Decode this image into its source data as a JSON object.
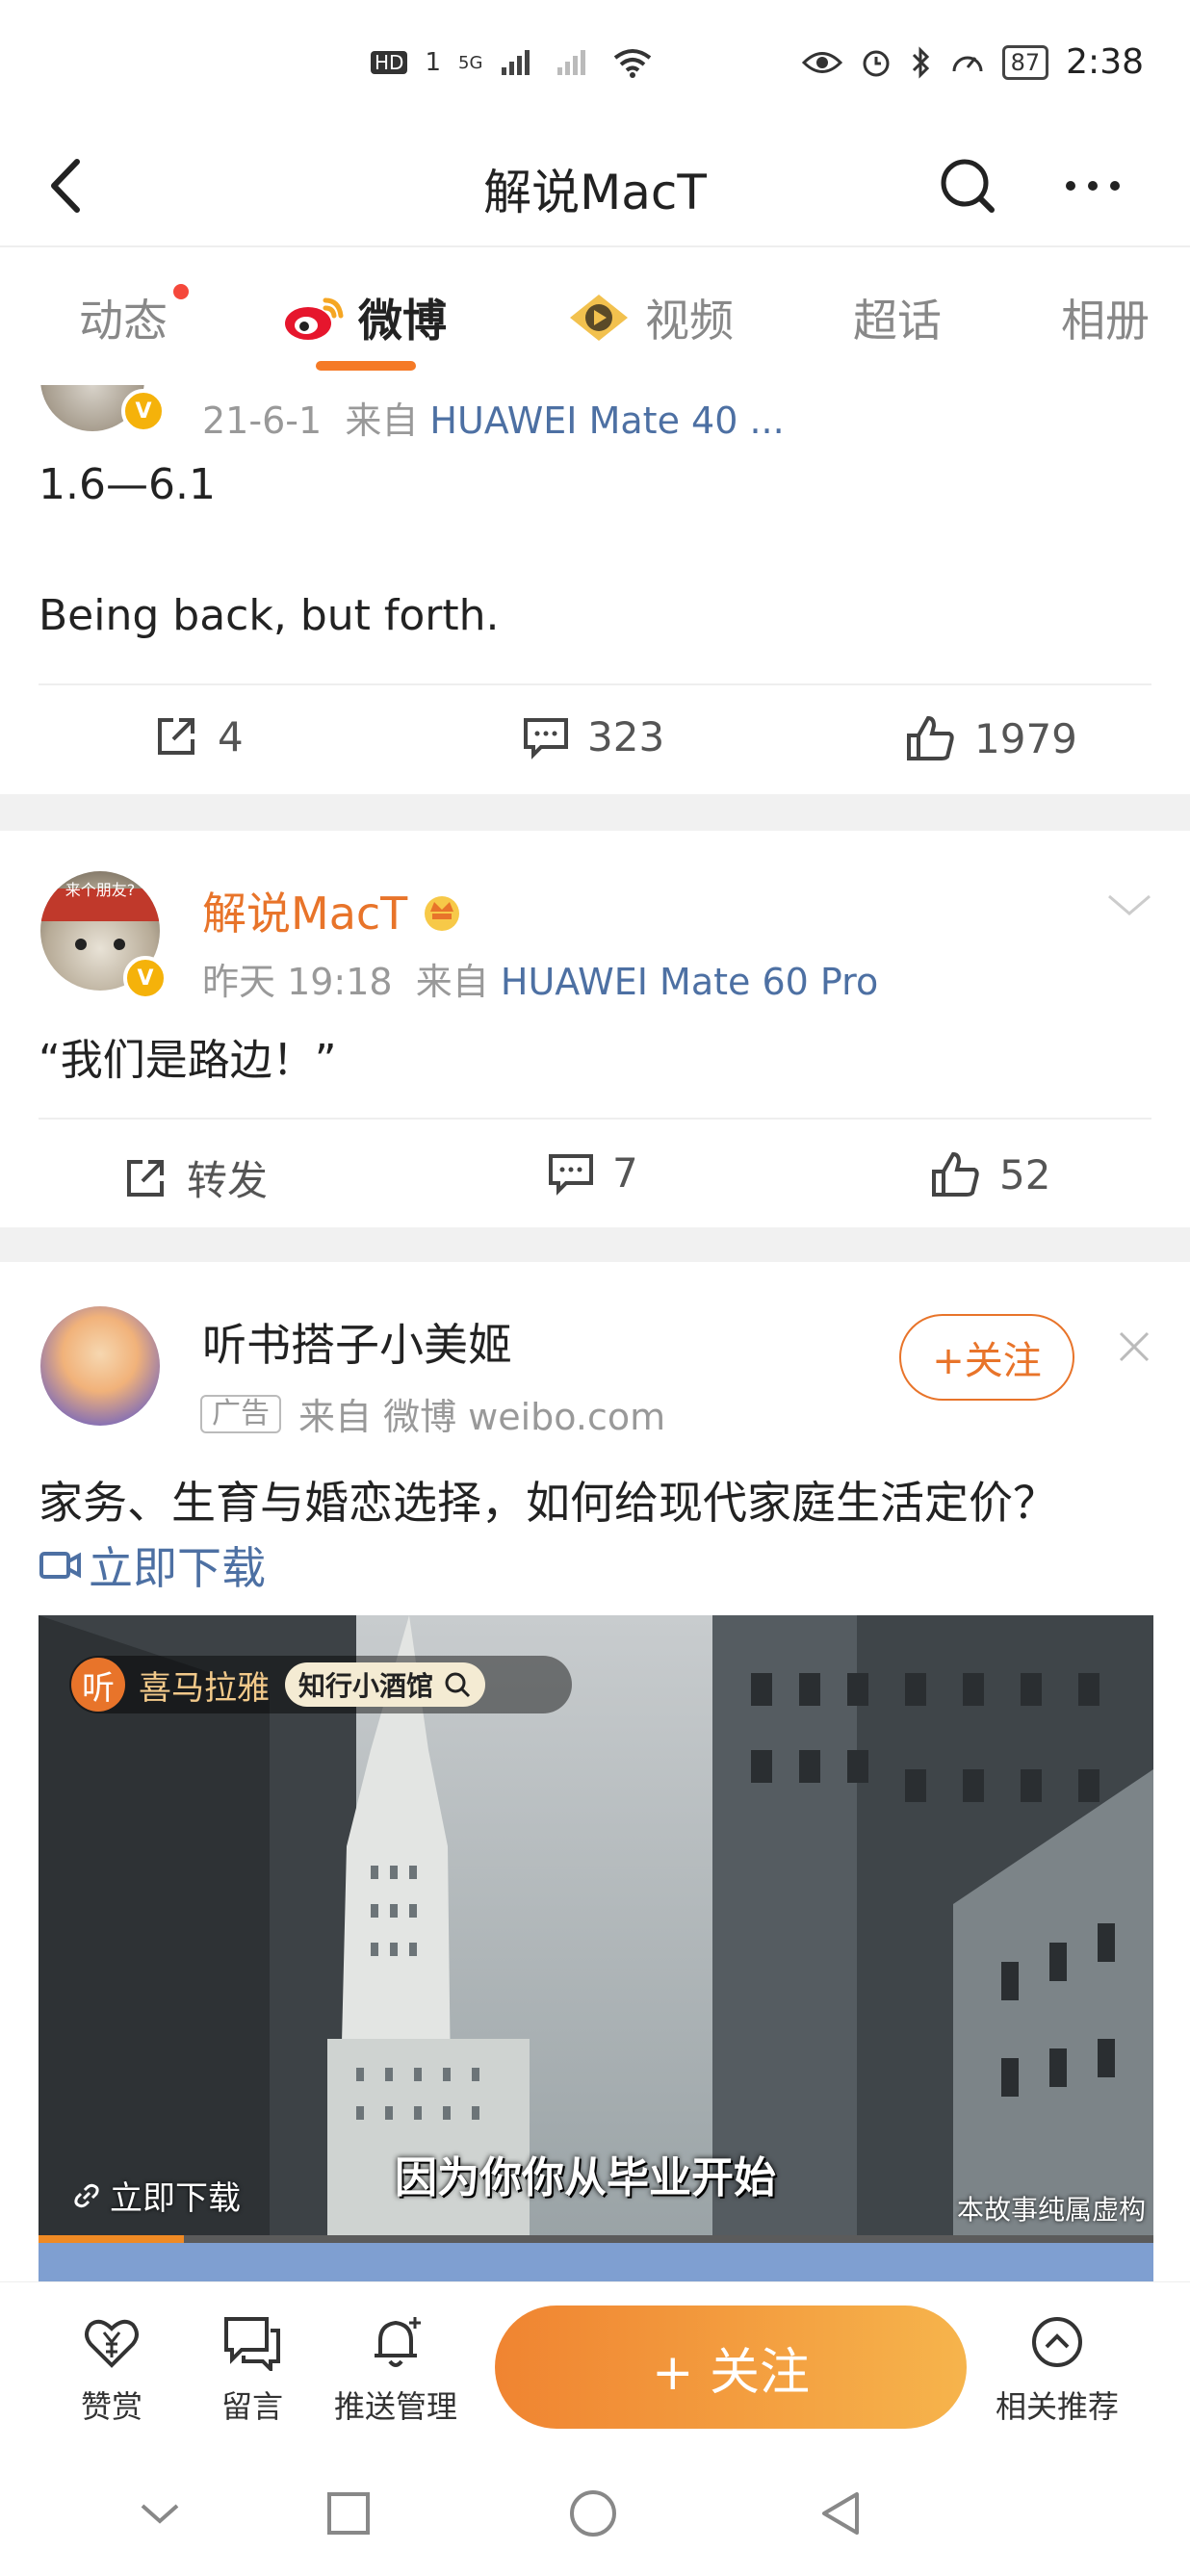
{
  "status_bar": {
    "left_indicators": [
      "HD",
      "1",
      "5G"
    ],
    "battery": "87",
    "time": "2:38"
  },
  "header": {
    "title": "解说MacT",
    "icons": [
      "back-arrow-icon",
      "search-icon",
      "more-icon"
    ]
  },
  "tabs": [
    {
      "label": "动态",
      "has_dot": true
    },
    {
      "label": "微博",
      "active": true,
      "icon": "weibo-logo-icon"
    },
    {
      "label": "视频",
      "icon": "video-icon"
    },
    {
      "label": "超话"
    },
    {
      "label": "相册"
    }
  ],
  "post1": {
    "meta_date": "21-6-1",
    "meta_from": "来自",
    "meta_source": "HUAWEI Mate 40 ...",
    "line1": "1.6—6.1",
    "line2": "Being back, but forth.",
    "repost": "4",
    "comments": "323",
    "likes": "1979"
  },
  "post2": {
    "username": "解说MacT",
    "meta_time": "昨天 19:18",
    "meta_from": "来自",
    "meta_source": "HUAWEI Mate 60 Pro",
    "text": "“我们是路边！”",
    "repost": "转发",
    "comments": "7",
    "likes": "52",
    "avatar_caption": "来个朋友?"
  },
  "ad_post": {
    "username": "听书搭子小美姬",
    "ad_tag": "广告",
    "meta": "来自 微博 weibo.com",
    "follow_label": "+关注",
    "text": "家务、生育与婚恋选择，如何给现代家庭生活定价？",
    "download_link": "立即下载",
    "video": {
      "brand": "喜马拉雅",
      "brand_short": "听",
      "search_text": "知行小酒馆",
      "caption": "因为你你从毕业开始",
      "download_label": "立即下载",
      "disclaimer": "本故事纯属虚构",
      "progress_fraction": 0.13
    }
  },
  "bottom_bar": {
    "items": [
      {
        "label": "赞赏",
        "icon": "reward-icon"
      },
      {
        "label": "留言",
        "icon": "message-icon"
      },
      {
        "label": "推送管理",
        "icon": "bell-icon"
      },
      {
        "label": "相关推荐",
        "icon": "recommend-icon"
      }
    ],
    "follow_label": "+ 关注"
  },
  "colors": {
    "accent_orange": "#e8742a",
    "link_blue": "#4d70a3",
    "vip_badge": "#f5b20a"
  }
}
